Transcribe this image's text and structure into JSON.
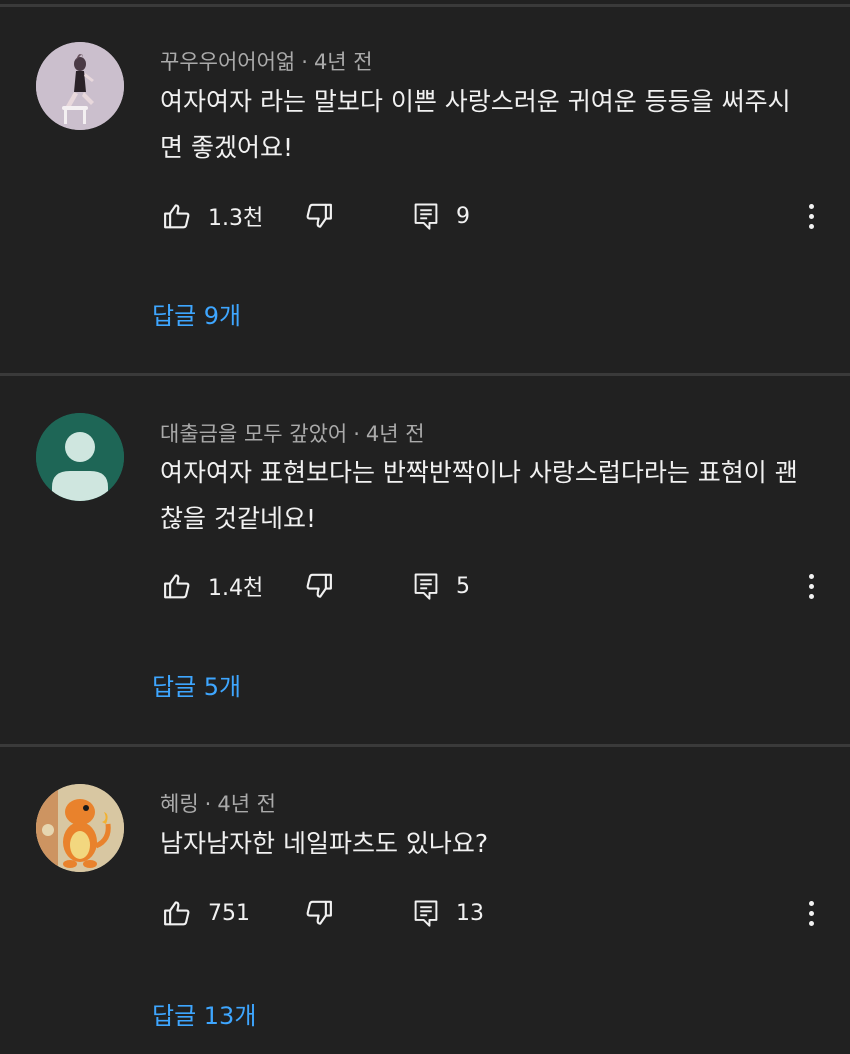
{
  "comments": [
    {
      "author": "꾸우우어어어얾",
      "age": "4년 전",
      "text": "여자여자 라는 말보다 이쁜 사랑스러운 귀여운 등등을 써주시면 좋겠어요!",
      "likes": "1.3천",
      "reply_count": "9",
      "replies_label": "답글 9개",
      "avatar_icon": "profile-photo-icon"
    },
    {
      "author": "대출금을 모두 갚았어",
      "age": "4년 전",
      "text": "여자여자 표현보다는 반짝반짝이나 사랑스럽다라는 표현이 괜찮을 것같네요!",
      "likes": "1.4천",
      "reply_count": "5",
      "replies_label": "답글 5개",
      "avatar_icon": "default-user-icon"
    },
    {
      "author": "혜링",
      "age": "4년 전",
      "text": "남자남자한 네일파츠도 있나요?",
      "likes": "751",
      "reply_count": "13",
      "replies_label": "답글 13개",
      "avatar_icon": "charmander-avatar-icon"
    }
  ],
  "colors": {
    "background": "#212121",
    "text": "#f1f1f1",
    "meta": "#aaaaaa",
    "link": "#3ea6ff",
    "divider": "#3a3a3a"
  }
}
